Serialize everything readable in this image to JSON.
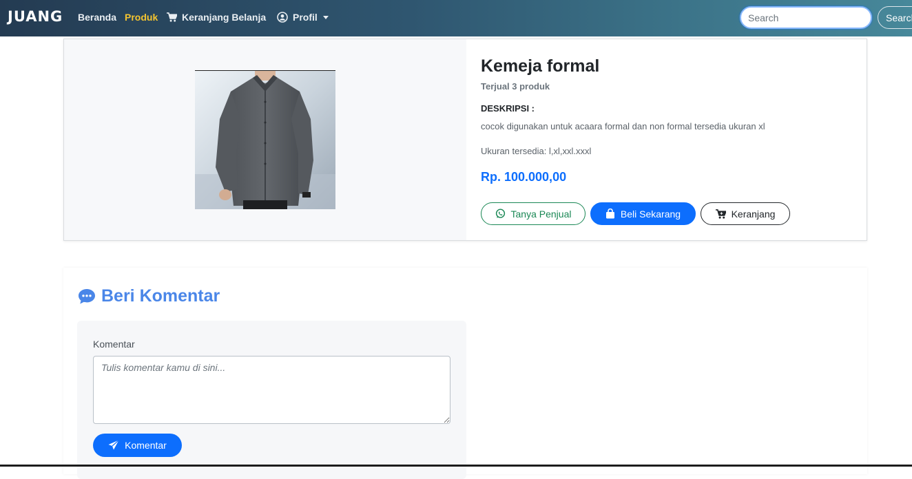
{
  "navbar": {
    "brand": "JUANG",
    "links": [
      {
        "label": "Beranda",
        "active": false
      },
      {
        "label": "Produk",
        "active": true
      },
      {
        "label": "Keranjang Belanja",
        "icon": "cart-icon",
        "active": false
      },
      {
        "label": "Profil",
        "icon": "user-circle-icon",
        "active": false
      }
    ],
    "search_placeholder": "Search",
    "search_button": "Search"
  },
  "product": {
    "name": "Kemeja formal",
    "sold": "Terjual 3 produk",
    "description_heading": "DESKRIPSI :",
    "description": "cocok digunakan untuk acaara formal dan non formal tersedia ukuran xl",
    "sizes": "Ukuran tersedia: l,xl,xxl.xxxl",
    "price": "Rp. 100.000,00",
    "buttons": {
      "ask_seller": "Tanya Penjual",
      "buy_now": "Beli Sekarang",
      "cart": "Keranjang"
    }
  },
  "comments": {
    "heading": "Beri Komentar",
    "label": "Komentar",
    "placeholder": "Tulis komentar kamu di sini...",
    "submit": "Komentar"
  },
  "colors": {
    "accent": "#0d6efd",
    "active_nav": "#f4c430",
    "whatsapp": "#198754",
    "heading_blue": "#4a86e8"
  }
}
